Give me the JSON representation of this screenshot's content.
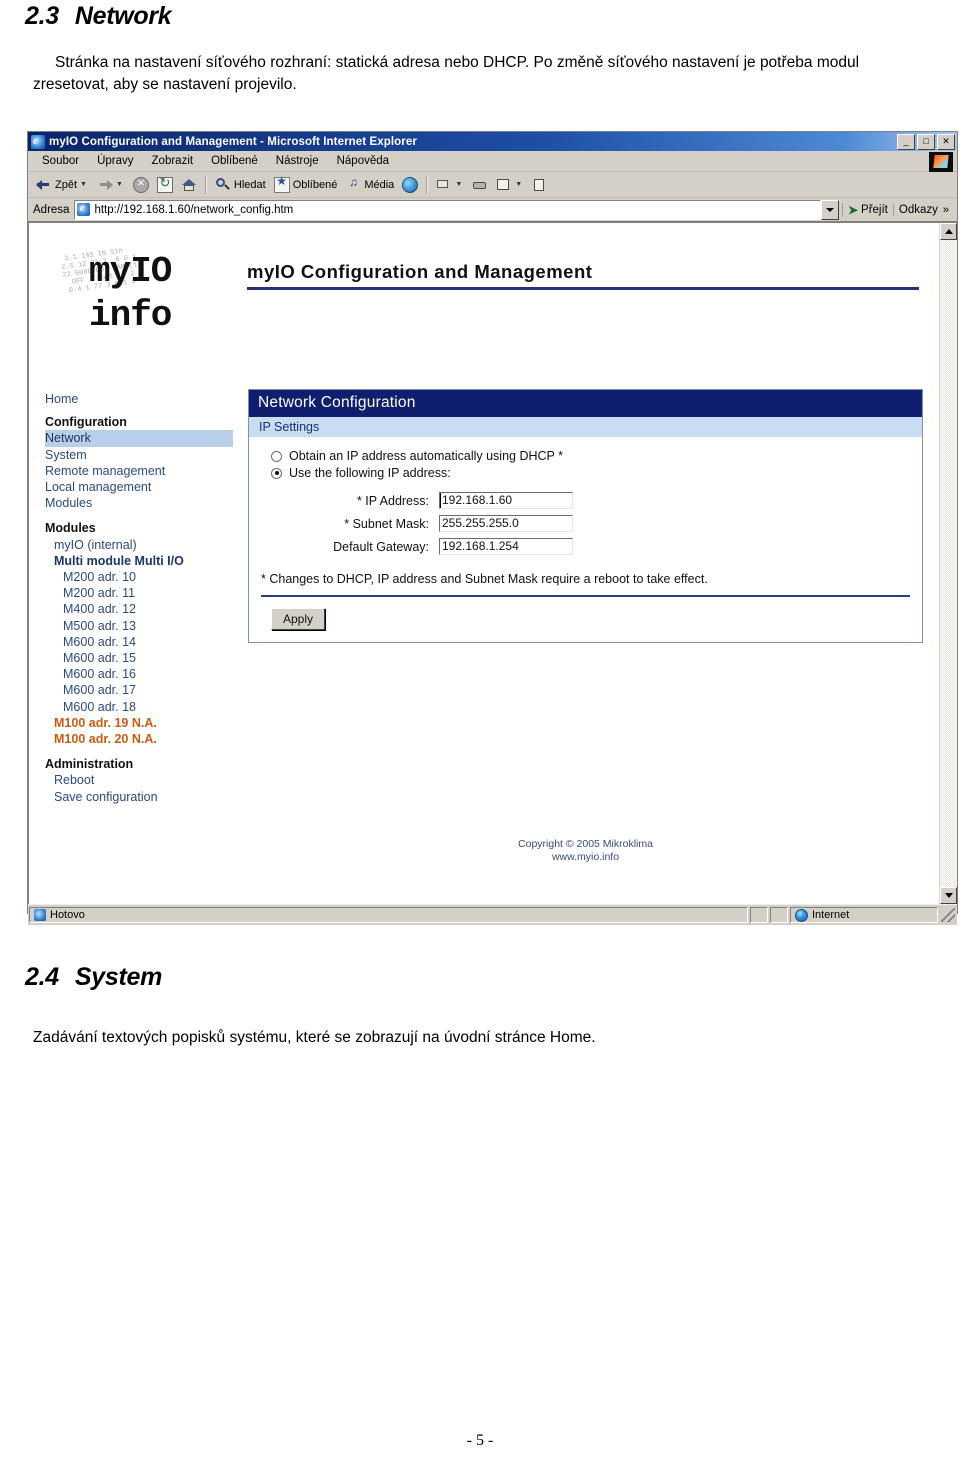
{
  "document": {
    "section_1": {
      "number": "2.3",
      "title": "Network",
      "paragraph": "Stránka na nastavení síťového rozhraní: statická adresa nebo DHCP. Po změně síťového nastavení je potřeba modul zresetovat, aby se nastavení projevilo."
    },
    "section_2": {
      "number": "2.4",
      "title": "System",
      "paragraph": "Zadávání textových popisků systému, které se zobrazují na úvodní stránce Home."
    },
    "page_number": "- 5 -"
  },
  "browser": {
    "titlebar": {
      "title": "myIO  Configuration and Management - Microsoft Internet Explorer",
      "icon": "ie-icon",
      "minimize": "_",
      "maximize": "□",
      "close": "✕"
    },
    "menubar": {
      "items": [
        {
          "label": "Soubor",
          "accel": "S"
        },
        {
          "label": "Úpravy",
          "accel": "p"
        },
        {
          "label": "Zobrazit",
          "accel": "Z"
        },
        {
          "label": "Oblíbené",
          "accel": "O"
        },
        {
          "label": "Nástroje",
          "accel": "N"
        },
        {
          "label": "Nápověda",
          "accel": "v"
        }
      ]
    },
    "toolbar": {
      "back": "Zpět",
      "forward": "",
      "stop": "",
      "refresh": "",
      "home": "",
      "search": "Hledat",
      "favorites": "Oblíbené",
      "media": "Média",
      "history": "",
      "mail": "",
      "print": "",
      "edit": "",
      "discuss": ""
    },
    "address": {
      "label": "Adresa",
      "url": "http://192.168.1.60/network_config.htm",
      "go_label": "Přejít",
      "links_label": "Odkazy",
      "links_chevron": "»"
    },
    "statusbar": {
      "status": "Hotovo",
      "zone": "Internet"
    }
  },
  "webpage": {
    "logo": {
      "line1": "myIO",
      "line2": "info"
    },
    "header_title": "myIO  Configuration and Management",
    "sidebar": {
      "home": "Home",
      "group_configuration": "Configuration",
      "config_items": [
        {
          "label": "Network",
          "selected": true
        },
        {
          "label": "System",
          "selected": false
        },
        {
          "label": "Remote management",
          "selected": false
        },
        {
          "label": "Local management",
          "selected": false
        },
        {
          "label": "Modules",
          "selected": false
        }
      ],
      "group_modules": "Modules",
      "module_internal": "myIO (internal)",
      "module_multi": "Multi module Multi I/O",
      "module_items": [
        {
          "label": "M200 adr. 10",
          "na": false
        },
        {
          "label": "M200 adr. 11",
          "na": false
        },
        {
          "label": "M400 adr. 12",
          "na": false
        },
        {
          "label": "M500 adr. 13",
          "na": false
        },
        {
          "label": "M600 adr. 14",
          "na": false
        },
        {
          "label": "M600 adr. 15",
          "na": false
        },
        {
          "label": "M600 adr. 16",
          "na": false
        },
        {
          "label": "M600 adr. 17",
          "na": false
        },
        {
          "label": "M600 adr. 18",
          "na": false
        },
        {
          "label": "M100 adr. 19 N.A.",
          "na": true
        },
        {
          "label": "M100 adr. 20 N.A.",
          "na": true
        }
      ],
      "group_administration": "Administration",
      "admin_items": [
        {
          "label": "Reboot"
        },
        {
          "label": "Save configuration"
        }
      ]
    },
    "panel": {
      "header": "Network Configuration",
      "subheader": "IP Settings",
      "radio_dhcp": "Obtain an IP address automatically using DHCP *",
      "radio_static": "Use the following IP address:",
      "fields": [
        {
          "label": "* IP Address:",
          "value": "192.168.1.60"
        },
        {
          "label": "* Subnet Mask:",
          "value": "255.255.255.0"
        },
        {
          "label": "Default Gateway:",
          "value": "192.168.1.254"
        }
      ],
      "note": "* Changes to DHCP, IP address and Subnet Mask require a reboot to take effect.",
      "apply_label": "Apply"
    },
    "footer": {
      "copyright": "Copyright © 2005 Mikroklima",
      "website": "www.myio.info"
    },
    "colors": {
      "panel_header_bg": "#0f1f6e",
      "panel_sub_bg": "#c9dcf2",
      "nav_selected_bg": "#b9cfe9",
      "nav_link": "#2b4a80",
      "na_color": "#cc5a11",
      "title_underline": "#262f7a"
    }
  }
}
